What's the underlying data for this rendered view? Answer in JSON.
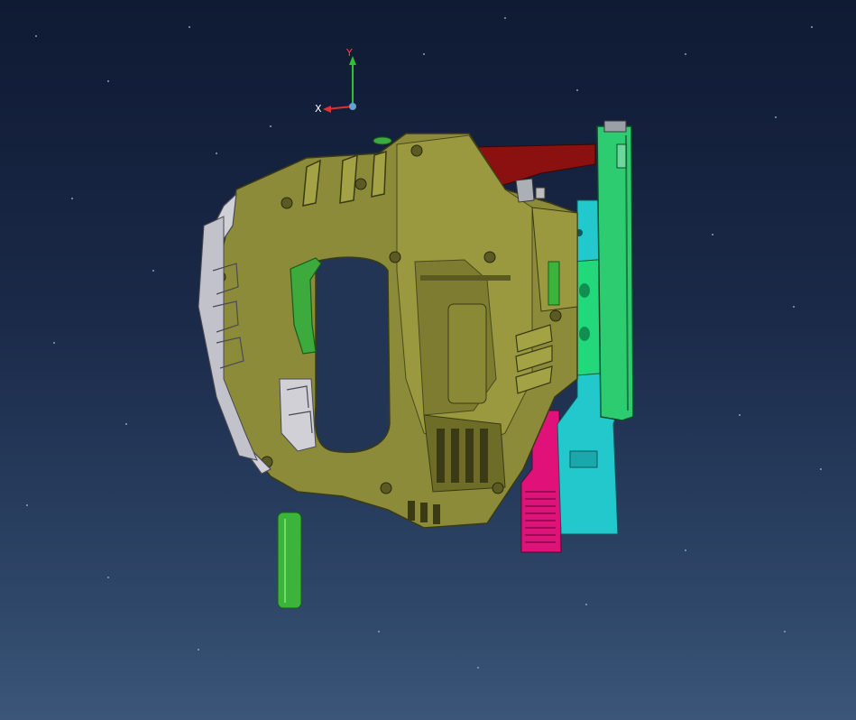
{
  "window": {
    "type": "cad-3d-viewport"
  },
  "compass": {
    "x_label": "X",
    "y_label": "Y"
  },
  "colors": {
    "background_top": "#0f1a33",
    "background_bottom": "#3a5678",
    "housing": "#8c8b3a",
    "housing_dark": "#4a4a1e",
    "grip_gray": "#d0d0d6",
    "trigger_green": "#3caa3c",
    "lever_red": "#8b1010",
    "cyan_part": "#22c8cc",
    "blade_holder_green": "#22d87a",
    "magenta_part": "#e0127a",
    "cord_green": "#3cb43c",
    "axis_x": "#e03030",
    "axis_y": "#30c030"
  },
  "model": {
    "parts": [
      {
        "name": "main-housing"
      },
      {
        "name": "handle-grip"
      },
      {
        "name": "trigger"
      },
      {
        "name": "power-cord"
      },
      {
        "name": "top-lever"
      },
      {
        "name": "blade-guide"
      },
      {
        "name": "blade-holder"
      },
      {
        "name": "base-plate"
      },
      {
        "name": "side-clamp"
      }
    ]
  }
}
